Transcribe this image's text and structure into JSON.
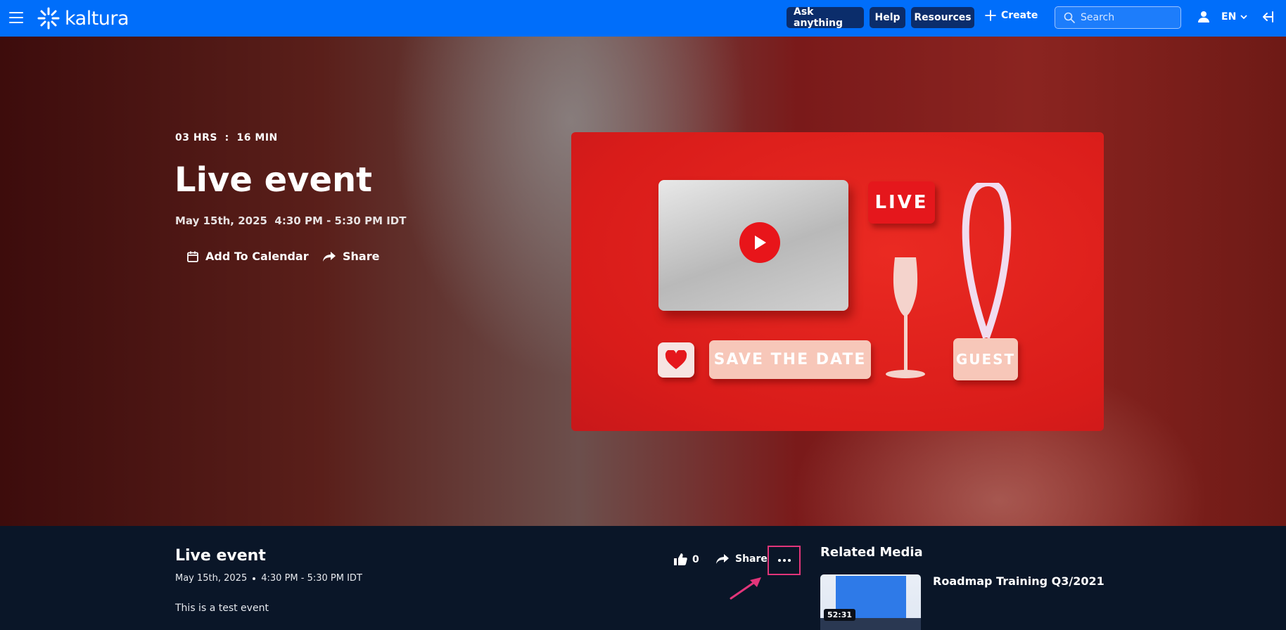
{
  "header": {
    "logo_text": "kaltura",
    "ask_label": "Ask anything",
    "help_label": "Help",
    "resources_label": "Resources",
    "create_label": "Create",
    "search_placeholder": "Search",
    "language": "EN",
    "colors": {
      "bar": "#006efa",
      "button": "#0b2d6b"
    }
  },
  "hero": {
    "timer": "03 HRS  :  16 MIN",
    "title": "Live event",
    "date": "May 15th, 2025  4:30 PM - 5:30 PM IDT",
    "add_to_calendar_label": "Add To Calendar",
    "share_label": "Share",
    "thumbnail": {
      "live_text": "LIVE",
      "save_date_text": "SAVE THE DATE",
      "guest_text": "GUEST"
    }
  },
  "details": {
    "title": "Live event",
    "date": "May 15th, 2025",
    "time": "4:30 PM - 5:30 PM IDT",
    "description": "This is a test event",
    "likes": "0",
    "share_label": "Share",
    "more_label": "···",
    "annotation_color": "#e2357a"
  },
  "related": {
    "heading": "Related Media",
    "items": [
      {
        "title": "Roadmap Training Q3/2021",
        "duration": "52:31"
      }
    ]
  }
}
